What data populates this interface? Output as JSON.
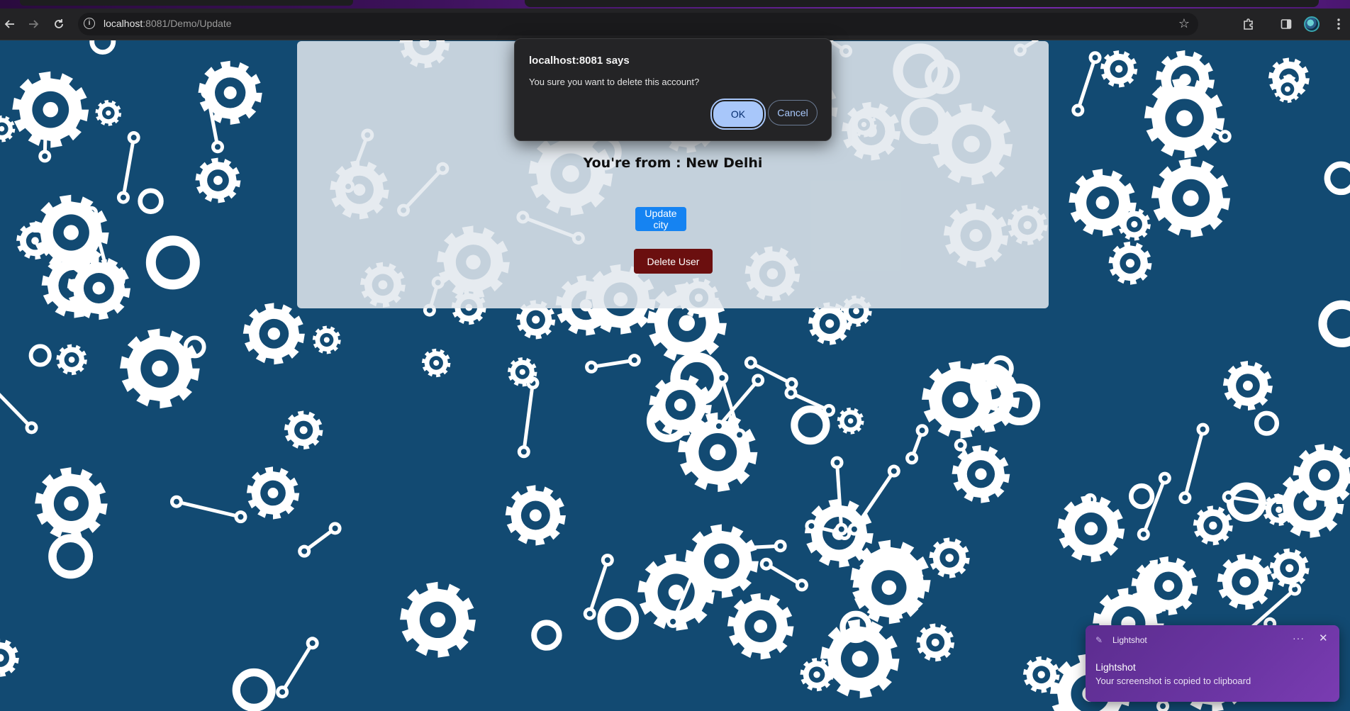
{
  "browser": {
    "url_host": "localhost",
    "url_rest": ":8081/Demo/Update",
    "icons": {
      "back": "back-arrow-icon",
      "forward": "forward-arrow-icon",
      "reload": "reload-icon",
      "site_info": "info-icon",
      "bookmark": "star-icon",
      "extensions": "puzzle-icon",
      "side_panel": "side-panel-icon",
      "menu": "kebab-menu-icon"
    }
  },
  "page": {
    "city_text": "You're from : New Delhi",
    "update_button": "Update city",
    "delete_button": "Delete User"
  },
  "dialog": {
    "title": "localhost:8081 says",
    "message": "You sure you want to delete this account?",
    "ok_label": "OK",
    "cancel_label": "Cancel"
  },
  "toast": {
    "app_name": "Lightshot",
    "title": "Lightshot",
    "body": "Your screenshot is copied to clipboard",
    "more": "···",
    "close": "✕"
  },
  "colors": {
    "background": "#124a72",
    "update_button": "#1583f2",
    "delete_button": "#6b0f0f",
    "dialog_ok": "#a8c7fa",
    "toast": "#6b35a3"
  }
}
